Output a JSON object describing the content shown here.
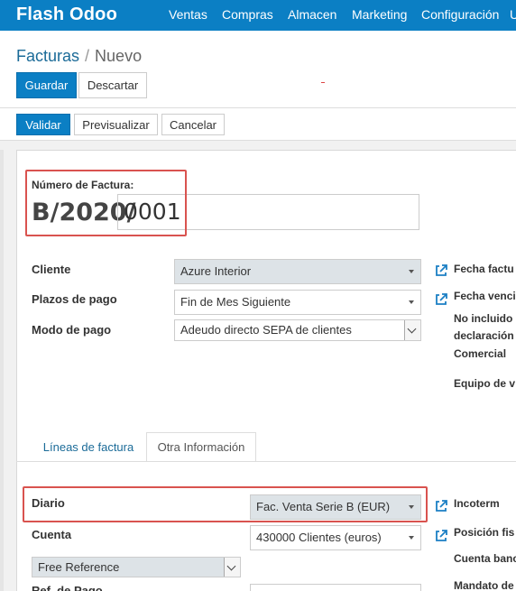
{
  "navbar": {
    "brand": "Flash Odoo",
    "menu": [
      "Ventas",
      "Compras",
      "Almacen",
      "Marketing",
      "Configuración",
      "U"
    ]
  },
  "breadcrumb": {
    "parent": "Facturas",
    "separator": "/",
    "current": "Nuevo"
  },
  "actions": {
    "save": "Guardar",
    "discard": "Descartar"
  },
  "statusbar": {
    "validate": "Validar",
    "preview": "Previsualizar",
    "cancel": "Cancelar"
  },
  "invoice": {
    "number_label": "Número de Factura:",
    "prefix": "B/2020/",
    "number": "0001"
  },
  "fields": {
    "cliente": {
      "label": "Cliente",
      "value": "Azure Interior"
    },
    "plazos": {
      "label": "Plazos de pago",
      "value": "Fin de Mes Siguiente"
    },
    "modo": {
      "label": "Modo de pago",
      "value": "Adeudo directo SEPA de clientes"
    }
  },
  "right_fields": {
    "fecha_factura": "Fecha factu",
    "fecha_venc": "Fecha venci",
    "no_incluido": "No incluido",
    "declaracion": "declaración",
    "comercial": "Comercial",
    "equipo": "Equipo de v"
  },
  "tabs": {
    "lines": "Líneas de factura",
    "other": "Otra Información"
  },
  "other_info": {
    "diario": {
      "label": "Diario",
      "value": "Fac. Venta Serie B (EUR)"
    },
    "cuenta": {
      "label": "Cuenta",
      "value": "430000 Clientes (euros)"
    },
    "reference": {
      "value": "Free Reference"
    },
    "ref_pago": {
      "label": "Ref. de Pago"
    },
    "incoterm": "Incoterm",
    "posicion": "Posición fis",
    "cuenta_banc": "Cuenta banc",
    "mandato": "Mandato de"
  },
  "icon_names": [
    "external-link-icon",
    "dropdown-caret-icon"
  ],
  "colors": {
    "brand_blue": "#0b7fc4",
    "link_blue": "#1b6b98",
    "highlight_red": "#d9534f"
  }
}
